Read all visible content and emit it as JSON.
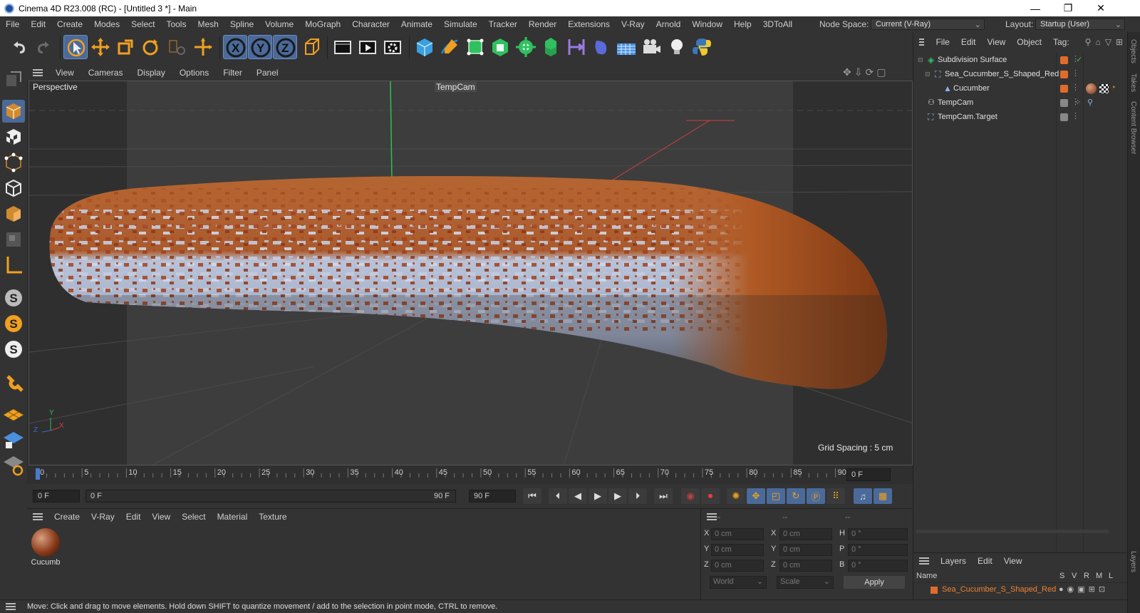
{
  "window": {
    "title": "Cinema 4D R23.008 (RC) - [Untitled 3 *] - Main",
    "controls": {
      "minimize": "—",
      "restore": "❐",
      "close": "✕"
    }
  },
  "menubar": {
    "items": [
      "File",
      "Edit",
      "Create",
      "Modes",
      "Select",
      "Tools",
      "Mesh",
      "Spline",
      "Volume",
      "MoGraph",
      "Character",
      "Animate",
      "Simulate",
      "Tracker",
      "Render",
      "Extensions",
      "V-Ray",
      "Arnold",
      "Window",
      "Help",
      "3DToAll"
    ],
    "node_space_label": "Node Space:",
    "node_space_value": "Current (V-Ray)",
    "layout_label": "Layout:",
    "layout_value": "Startup (User)"
  },
  "toolbar": {
    "icons": [
      "undo-icon",
      "redo-icon",
      "select-live-icon",
      "move-icon",
      "scale-icon",
      "rotate-icon",
      "recent-tool-icon",
      "coord-system-icon",
      "x-axis-icon",
      "y-axis-icon",
      "z-axis-icon",
      "world-coord-icon",
      "render-region-icon",
      "render-view-icon",
      "render-settings-icon",
      "cube-icon",
      "pen-icon",
      "subdivision-icon",
      "extrude-icon",
      "cloner-icon",
      "mograph-icon",
      "deformer-icon",
      "field-icon",
      "floor-icon",
      "camera-icon",
      "light-icon",
      "python-icon"
    ],
    "axis_labels": [
      "X",
      "Y",
      "Z"
    ]
  },
  "viewport": {
    "menu": [
      "View",
      "Cameras",
      "Display",
      "Options",
      "Filter",
      "Panel"
    ],
    "view_name": "Perspective",
    "camera_name": "TempCam",
    "grid_spacing": "Grid Spacing : 5 cm",
    "axis": {
      "y": "Y",
      "z": "Z",
      "x": "X"
    },
    "colors": {
      "background": "#3d3d3d",
      "safe_frame": "#2e2e2e",
      "y_axis": "#2fbf4f",
      "x_axis": "#d04040"
    }
  },
  "timeline": {
    "ticks": [
      "0",
      "5",
      "10",
      "15",
      "20",
      "25",
      "30",
      "35",
      "40",
      "45",
      "50",
      "55",
      "60",
      "65",
      "70",
      "75",
      "80",
      "85",
      "90"
    ],
    "current_frame": "0 F",
    "start_field": "0 F",
    "range_start": "0 F",
    "range_end": "90 F",
    "end_field": "90 F"
  },
  "materials": {
    "menu": [
      "Create",
      "V-Ray",
      "Edit",
      "View",
      "Select",
      "Material",
      "Texture"
    ],
    "items": [
      {
        "name": "Cucumb"
      }
    ]
  },
  "coordinates": {
    "headers": [
      "--",
      "--",
      "--"
    ],
    "rows": [
      {
        "a": "X",
        "av": "0 cm",
        "b": "X",
        "bv": "0 cm",
        "c": "H",
        "cv": "0 °"
      },
      {
        "a": "Y",
        "av": "0 cm",
        "b": "Y",
        "bv": "0 cm",
        "c": "P",
        "cv": "0 °"
      },
      {
        "a": "Z",
        "av": "0 cm",
        "b": "Z",
        "bv": "0 cm",
        "c": "B",
        "cv": "0 °"
      }
    ],
    "mode": "World",
    "transform": "Scale",
    "apply": "Apply"
  },
  "objects": {
    "menu": [
      "File",
      "Edit",
      "View",
      "Object",
      "Tag:"
    ],
    "tree": [
      {
        "name": "Subdivision Surface",
        "tag_color": "#e06c2a"
      },
      {
        "name": "Sea_Cucumber_S_Shaped_Red",
        "tag_color": "#e06c2a"
      },
      {
        "name": "Cucumber",
        "tag_color": "#e06c2a"
      },
      {
        "name": "TempCam",
        "tag_color": "#888888"
      },
      {
        "name": "TempCam.Target",
        "tag_color": "#888888"
      }
    ],
    "side_tabs": [
      "Objects",
      "Takes",
      "Content Browser",
      "Layers"
    ]
  },
  "layers": {
    "menu": [
      "Layers",
      "Edit",
      "View"
    ],
    "columns": [
      "Name",
      "S",
      "V",
      "R",
      "M",
      "L"
    ],
    "rows": [
      {
        "name": "Sea_Cucumber_S_Shaped_Red",
        "color": "#e06c2a"
      }
    ]
  },
  "status": {
    "text": "Move: Click and drag to move elements. Hold down SHIFT to quantize movement / add to the selection in point mode, CTRL to remove."
  }
}
